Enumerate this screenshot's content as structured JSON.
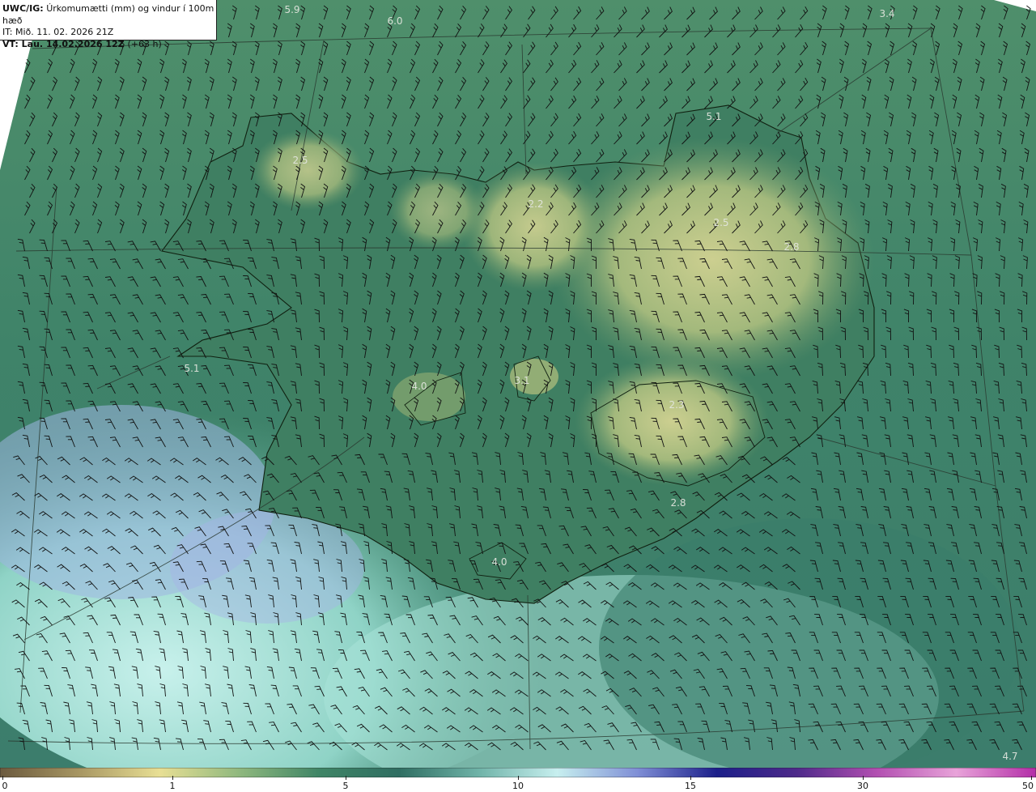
{
  "header": {
    "product": "UWC/IG:",
    "field": "Úrkomumætti (mm) og vindur í 100m hæð",
    "initial_time": "IT: Mið. 11. 02. 2026 21Z",
    "valid_prefix": "VT:",
    "valid_time": "Lau. 14.02.2026 12Z",
    "lead": "(+63 h)"
  },
  "value_labels": [
    "5.9",
    "6.0",
    "3.4",
    "5.1",
    "2.5",
    "2.2",
    "2.5",
    "2.8",
    "5.1",
    "4.0",
    "3.1",
    "2.3",
    "2.8",
    "4.0",
    "4.7"
  ],
  "colorbar": {
    "ticks": [
      "0",
      "1",
      "5",
      "10",
      "15",
      "30",
      "50"
    ],
    "colors": [
      "#6b5a3e",
      "#a89763",
      "#e8df94",
      "#8fb87e",
      "#3f8566",
      "#2f6e62",
      "#6fb3a8",
      "#c7efef",
      "#7f8fd6",
      "#1c1f8a",
      "#4e2a8a",
      "#b24fb1",
      "#e8a3d9",
      "#b32da7"
    ]
  },
  "colors": {
    "ocean_dark": "#3d7f66",
    "ocean_light": "#bfeee9",
    "land_low": "#3e7c62",
    "land_high": "#d7d592",
    "purple_band": "#a7b4e6"
  }
}
